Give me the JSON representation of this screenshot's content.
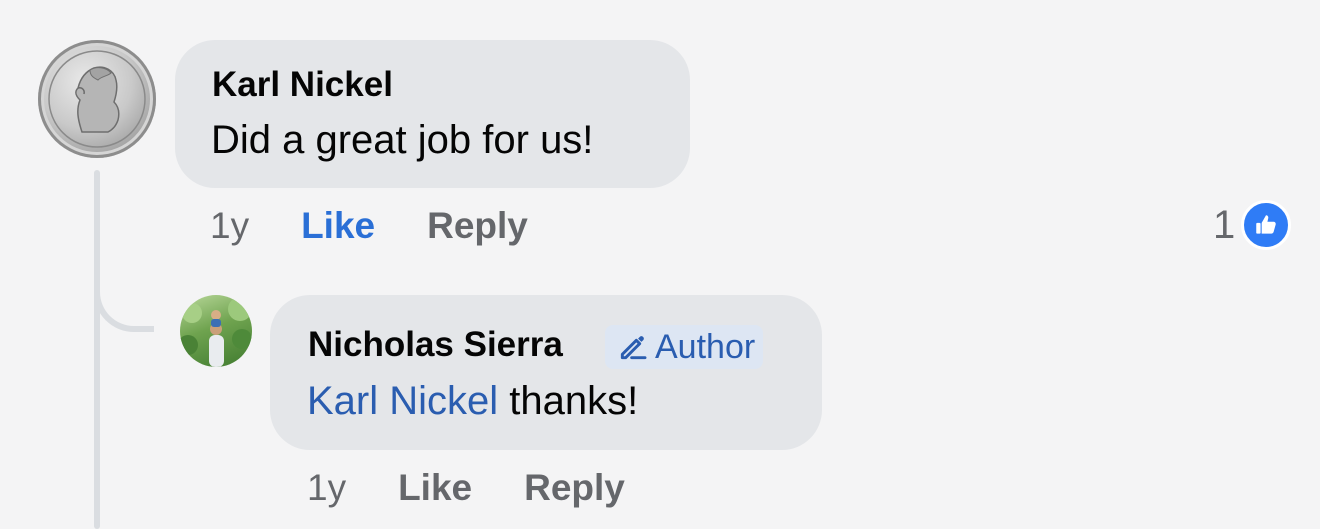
{
  "comments": [
    {
      "author": "Karl Nickel",
      "text": "Did a great job for us!",
      "time": "1y",
      "like_label": "Like",
      "reply_label": "Reply",
      "reaction_count": "1",
      "liked": true
    },
    {
      "author": "Nicholas Sierra",
      "badge": "Author",
      "mention": "Karl Nickel",
      "text": " thanks!",
      "time": "1y",
      "like_label": "Like",
      "reply_label": "Reply",
      "liked": false
    }
  ],
  "colors": {
    "background": "#f4f4f5",
    "bubble": "#e4e6e9",
    "accent": "#2a6fd6",
    "mention": "#2a5db0",
    "secondary_text": "#65676b",
    "thread_line": "#dadde1"
  },
  "icons": {
    "author_badge": "pencil-icon",
    "reaction": "thumbs-up-icon"
  }
}
